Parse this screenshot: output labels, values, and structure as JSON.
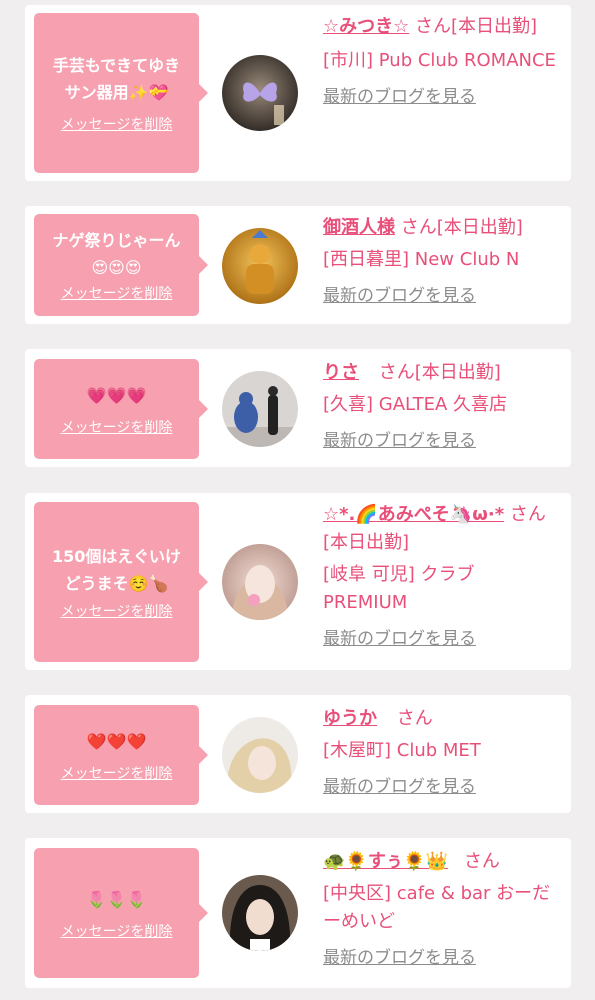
{
  "delete_label": "メッセージを削除",
  "blog_label": "最新のブログを見る",
  "suffix_honorific": "さん",
  "items": [
    {
      "message_line1": "手芸もできてゆき",
      "message_line2": "サン器用✨💝",
      "name": "☆みつき☆",
      "suffix": "さん[本日出勤]",
      "shop": "[市川] Pub Club ROMANCE",
      "avatar_icon": "butterfly-photo"
    },
    {
      "message_line1": "ナゲ祭りじゃーん",
      "message_line2": "😍😍😍",
      "name": "御酒人様",
      "suffix": "さん[本日出勤]",
      "shop": "[西日暮里] New Club N",
      "avatar_icon": "golden-statue-photo"
    },
    {
      "message_line1": "💗💗💗",
      "message_line2": "",
      "name": "りさ",
      "suffix": "さん[本日出勤]",
      "shop": "[久喜] GALTEA 久喜店",
      "avatar_icon": "gallery-photo"
    },
    {
      "message_line1": "150個はえぐいけ",
      "message_line2": "どうまそ☺️🍗",
      "name": "☆*.🌈あみぺそ🦄ω·*",
      "suffix": "さん[本日出勤]",
      "shop": "[岐阜 可児] クラブ PREMIUM",
      "avatar_icon": "selfie-photo"
    },
    {
      "message_line1": "❤️❤️❤️",
      "message_line2": "",
      "name": "ゆうか",
      "suffix": "さん",
      "shop": "[木屋町] Club MET",
      "avatar_icon": "blonde-selfie-photo"
    },
    {
      "message_line1": "🌷🌷🌷",
      "message_line2": "",
      "name": "🐢🌻すぅ🌻👑",
      "suffix": "さん",
      "shop": "[中央区] cafe & bar おーだーめいど",
      "avatar_icon": "portrait-photo"
    }
  ]
}
